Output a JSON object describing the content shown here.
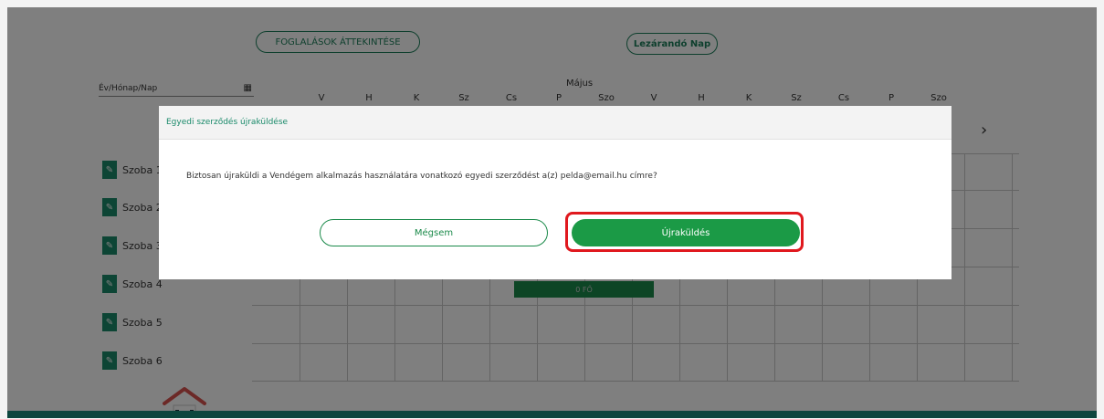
{
  "toolbar": {
    "overview_label": "FOGLALÁSOK ÁTTEKINTÉSE",
    "close_day_label": "Lezárandó Nap"
  },
  "calendar": {
    "date_label": "Év/Hónap/Nap",
    "month": "Május",
    "days": [
      "V",
      "H",
      "K",
      "Sz",
      "Cs",
      "P",
      "Szo",
      "V",
      "H",
      "K",
      "Sz",
      "Cs",
      "P",
      "Szo"
    ],
    "next_arrow": "›"
  },
  "rooms": [
    "Szoba 1",
    "Szoba 2",
    "Szoba 3",
    "Szoba 4",
    "Szoba 5",
    "Szoba 6"
  ],
  "booking": {
    "label": "0 FŐ"
  },
  "modal": {
    "title": "Egyedi szerződés újraküldése",
    "message": "Biztosan újraküldi a Vendégem alkalmazás használatára vonatkozó egyedi szerződést a(z) pelda@email.hu címre?",
    "cancel_label": "Mégsem",
    "resend_label": "Újraküldés"
  },
  "colors": {
    "brand": "#1b9a46",
    "highlight": "#e0181e",
    "teal": "#1b8c7d"
  }
}
